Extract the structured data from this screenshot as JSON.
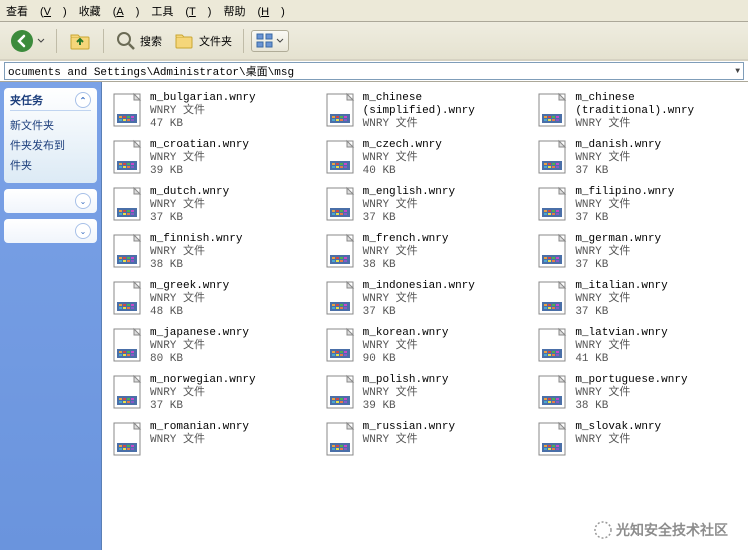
{
  "menu": {
    "view": "查看",
    "view_u": "V",
    "fav": "收藏",
    "fav_u": "A",
    "tools": "工具",
    "tools_u": "T",
    "help": "帮助",
    "help_u": "H"
  },
  "toolbar": {
    "search": "搜索",
    "folders": "文件夹"
  },
  "address": {
    "path": "ocuments and Settings\\Administrator\\桌面\\msg"
  },
  "sidebar": {
    "tasks_title": "夹任务",
    "items": [
      "新文件夹",
      "件夹发布到",
      "件夹"
    ]
  },
  "file_type_label": "WNRY 文件",
  "files": [
    {
      "name": "m_bulgarian.wnry",
      "size": "47 KB"
    },
    {
      "name": "m_chinese (simplified).wnry",
      "size": ""
    },
    {
      "name": "m_chinese (traditional).wnry",
      "size": ""
    },
    {
      "name": "m_croatian.wnry",
      "size": "39 KB"
    },
    {
      "name": "m_czech.wnry",
      "size": "40 KB"
    },
    {
      "name": "m_danish.wnry",
      "size": "37 KB"
    },
    {
      "name": "m_dutch.wnry",
      "size": "37 KB"
    },
    {
      "name": "m_english.wnry",
      "size": "37 KB"
    },
    {
      "name": "m_filipino.wnry",
      "size": "37 KB"
    },
    {
      "name": "m_finnish.wnry",
      "size": "38 KB"
    },
    {
      "name": "m_french.wnry",
      "size": "38 KB"
    },
    {
      "name": "m_german.wnry",
      "size": "37 KB"
    },
    {
      "name": "m_greek.wnry",
      "size": "48 KB"
    },
    {
      "name": "m_indonesian.wnry",
      "size": "37 KB"
    },
    {
      "name": "m_italian.wnry",
      "size": "37 KB"
    },
    {
      "name": "m_japanese.wnry",
      "size": "80 KB"
    },
    {
      "name": "m_korean.wnry",
      "size": "90 KB"
    },
    {
      "name": "m_latvian.wnry",
      "size": "41 KB"
    },
    {
      "name": "m_norwegian.wnry",
      "size": "37 KB"
    },
    {
      "name": "m_polish.wnry",
      "size": "39 KB"
    },
    {
      "name": "m_portuguese.wnry",
      "size": "38 KB"
    },
    {
      "name": "m_romanian.wnry",
      "size": ""
    },
    {
      "name": "m_russian.wnry",
      "size": ""
    },
    {
      "name": "m_slovak.wnry",
      "size": ""
    }
  ],
  "watermark": "光知安全技术社区"
}
